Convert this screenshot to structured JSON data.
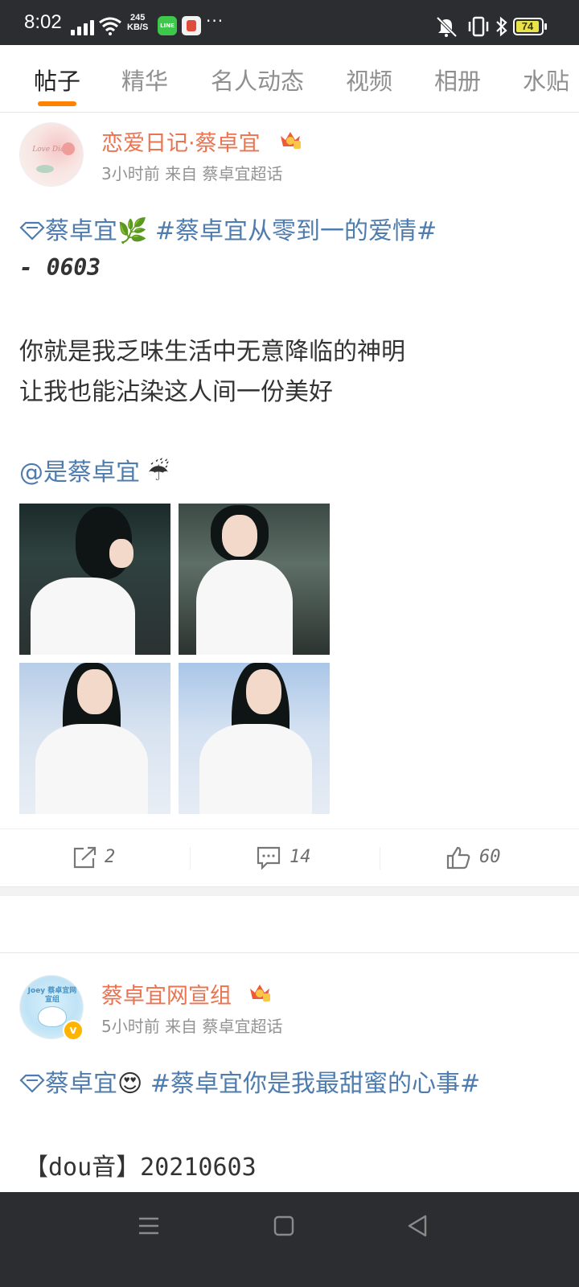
{
  "status_bar": {
    "time": "8:02",
    "net_speed_value": "245",
    "net_speed_unit": "KB/S",
    "line_app": "LINE",
    "more": "···",
    "battery": "74"
  },
  "tabs": [
    {
      "label": "帖子",
      "active": true
    },
    {
      "label": "精华",
      "active": false
    },
    {
      "label": "名人动态",
      "active": false
    },
    {
      "label": "视频",
      "active": false
    },
    {
      "label": "相册",
      "active": false
    },
    {
      "label": "水贴",
      "active": false
    }
  ],
  "posts": [
    {
      "author": "恋爱日记·蔡卓宜",
      "time": "3小时前",
      "source_prefix": "来自",
      "source": "蔡卓宜超话",
      "topic_name": "蔡卓宜",
      "topic_emoji": "🌿",
      "hashtag": "#蔡卓宜从零到一的爱情#",
      "date_line": "- 0603",
      "line1": "你就是我乏味生活中无意降临的神明",
      "line2": "让我也能沾染这人间一份美好",
      "mention": "@是蔡卓宜",
      "mention_emoji": "☔",
      "actions": {
        "repost": "2",
        "comment": "14",
        "like": "60"
      }
    },
    {
      "author": "蔡卓宜网宣组",
      "avatar_text": "Joey 蔡卓宜网宣组",
      "verified": "v",
      "time": "5小时前",
      "source_prefix": "来自",
      "source": "蔡卓宜超话",
      "topic_name": "蔡卓宜",
      "topic_emoji": "😍",
      "hashtag": "#蔡卓宜你是我最甜蜜的心事#",
      "line1": "【dou音】20210603"
    }
  ],
  "colors": {
    "accent": "#ff8200",
    "username": "#eb7350",
    "topic": "#4f7cae",
    "statusbar": "#2b2d31"
  },
  "icons": [
    "signal-icon",
    "wifi-icon",
    "mute-icon",
    "vibrate-icon",
    "bluetooth-icon",
    "battery-icon",
    "crown-badge-icon",
    "diamond-topic-icon",
    "repost-icon",
    "comment-icon",
    "like-icon",
    "menu-icon",
    "home-icon",
    "back-icon"
  ]
}
